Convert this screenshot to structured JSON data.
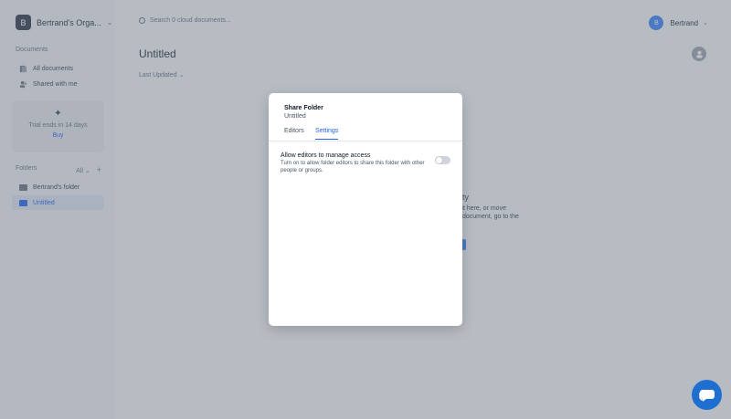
{
  "org": {
    "initial": "B",
    "name": "Bertrand's Orga..."
  },
  "sidebar": {
    "documents_label": "Documents",
    "items": [
      {
        "label": "All documents",
        "icon": "documents-icon"
      },
      {
        "label": "Shared with me",
        "icon": "shared-users-icon"
      }
    ],
    "trial": {
      "text": "Trial ends in 14 days",
      "cta": "Buy",
      "icon": "sparkle-icon"
    },
    "folders_label": "Folders",
    "folders_filter": "All",
    "folders": [
      {
        "label": "Bertrand's folder",
        "active": false
      },
      {
        "label": "Untitled",
        "active": true
      }
    ]
  },
  "header": {
    "search_placeholder": "Search 0 cloud documents...",
    "user_initial": "B",
    "user_name": "Bertrand"
  },
  "main": {
    "title": "Untitled",
    "sort_label": "Last Updated",
    "background_fragments": [
      "ty",
      "ve it here, or move",
      "document, go to the"
    ]
  },
  "modal": {
    "title": "Share Folder",
    "subtitle": "Untitled",
    "tabs": [
      {
        "label": "Editors",
        "active": false
      },
      {
        "label": "Settings",
        "active": true
      }
    ],
    "option_title": "Allow editors to manage access",
    "option_desc": "Turn on to allow folder editors to share this folder with other people or groups.",
    "toggle_on": false
  },
  "colors": {
    "accent": "#2563eb",
    "chat": "#1e6fd0",
    "overlay": "rgba(100,110,125,0.42)"
  }
}
